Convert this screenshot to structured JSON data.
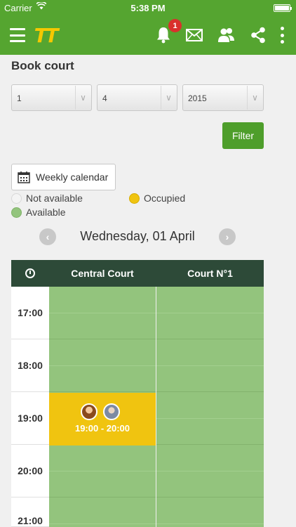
{
  "status_bar": {
    "carrier": "Carrier",
    "time": "5:38 PM"
  },
  "navbar": {
    "logo": "TT",
    "notification_count": "1",
    "icons": [
      "menu-icon",
      "bell-icon",
      "mail-icon",
      "users-icon",
      "share-icon",
      "more-vertical-icon"
    ]
  },
  "page": {
    "title": "Book court"
  },
  "filters": {
    "day": "1",
    "month": "4",
    "year": "2015",
    "filter_label": "Filter"
  },
  "weekly_calendar_label": "Weekly calendar",
  "legend": {
    "not_available": "Not available",
    "occupied": "Occupied",
    "available": "Available",
    "colors": {
      "not_available": "#f4f4f4",
      "occupied": "#f0c410",
      "available": "#93c47d"
    }
  },
  "date_nav": {
    "label": "Wednesday, 01 April"
  },
  "calendar": {
    "columns": [
      "Central Court",
      "Court N°1"
    ],
    "times": [
      "17:00",
      "18:00",
      "19:00",
      "20:00",
      "21:00"
    ],
    "booking": {
      "court": "Central Court",
      "time": "19:00 - 20:00"
    }
  },
  "colors": {
    "brand_green": "#55a530",
    "header_dark": "#2d4a38",
    "accent_yellow": "#f5c800",
    "badge_red": "#d9302c"
  }
}
